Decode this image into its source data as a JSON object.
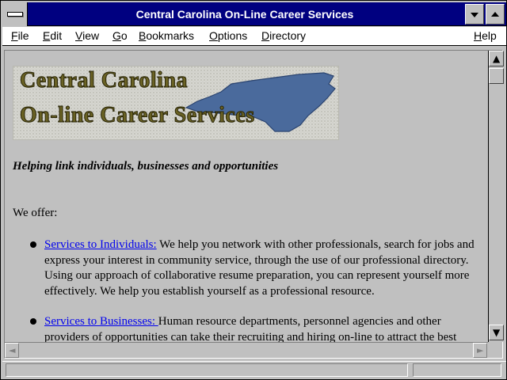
{
  "window": {
    "title": "Central Carolina On-Line Career Services"
  },
  "menu": {
    "items": [
      "File",
      "Edit",
      "View",
      "Go",
      "Bookmarks",
      "Options",
      "Directory"
    ],
    "help": "Help"
  },
  "page": {
    "banner": {
      "line1": "Central Carolina",
      "line2": "On-line Career Services"
    },
    "tagline": "Helping link individuals, businesses and opportunities",
    "offer_intro": "We offer:",
    "services": [
      {
        "link": "Services to Individuals:",
        "text": " We help you network with other professionals, search for jobs and express your interest in community service, through the use of our professional directory. Using our approach of collaborative resume preparation, you can represent yourself more effectively. We help you establish yourself as a professional resource."
      },
      {
        "link": "Services to Businesses: ",
        "text": "Human resource departments, personnel agencies and other providers of opportunities can take their recruiting and hiring on-line to attract the best"
      }
    ]
  },
  "status": {
    "text": ""
  },
  "colors": {
    "titlebar": "#000080",
    "link": "#0000ee",
    "background": "#c0c0c0",
    "map_fill": "#4a6a9c"
  }
}
